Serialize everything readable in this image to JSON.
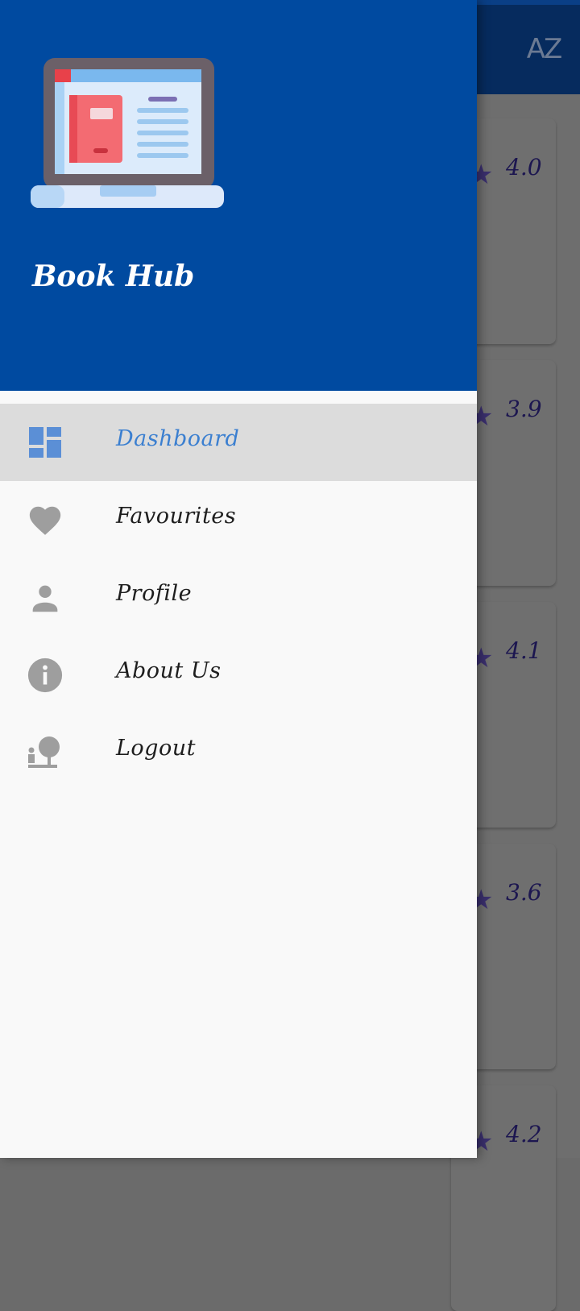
{
  "app": {
    "name": "Book Hub"
  },
  "toolbar": {
    "sort_label": "AZ"
  },
  "book_list": {
    "ratings": [
      "4.0",
      "3.9",
      "4.1",
      "3.6",
      "4.2"
    ]
  },
  "drawer": {
    "menu": [
      {
        "label": "Dashboard",
        "icon": "dashboard-icon",
        "active": true
      },
      {
        "label": "Favourites",
        "icon": "heart-icon",
        "active": false
      },
      {
        "label": "Profile",
        "icon": "person-icon",
        "active": false
      },
      {
        "label": "About Us",
        "icon": "info-icon",
        "active": false
      },
      {
        "label": "Logout",
        "icon": "logout-icon",
        "active": false
      }
    ]
  },
  "colors": {
    "header_bg": "#004aa0",
    "active_item_bg": "#dcdcdc",
    "active_label": "#3b7fd0",
    "icon_gray": "#9e9e9e",
    "active_icon": "#5b8fd6"
  }
}
